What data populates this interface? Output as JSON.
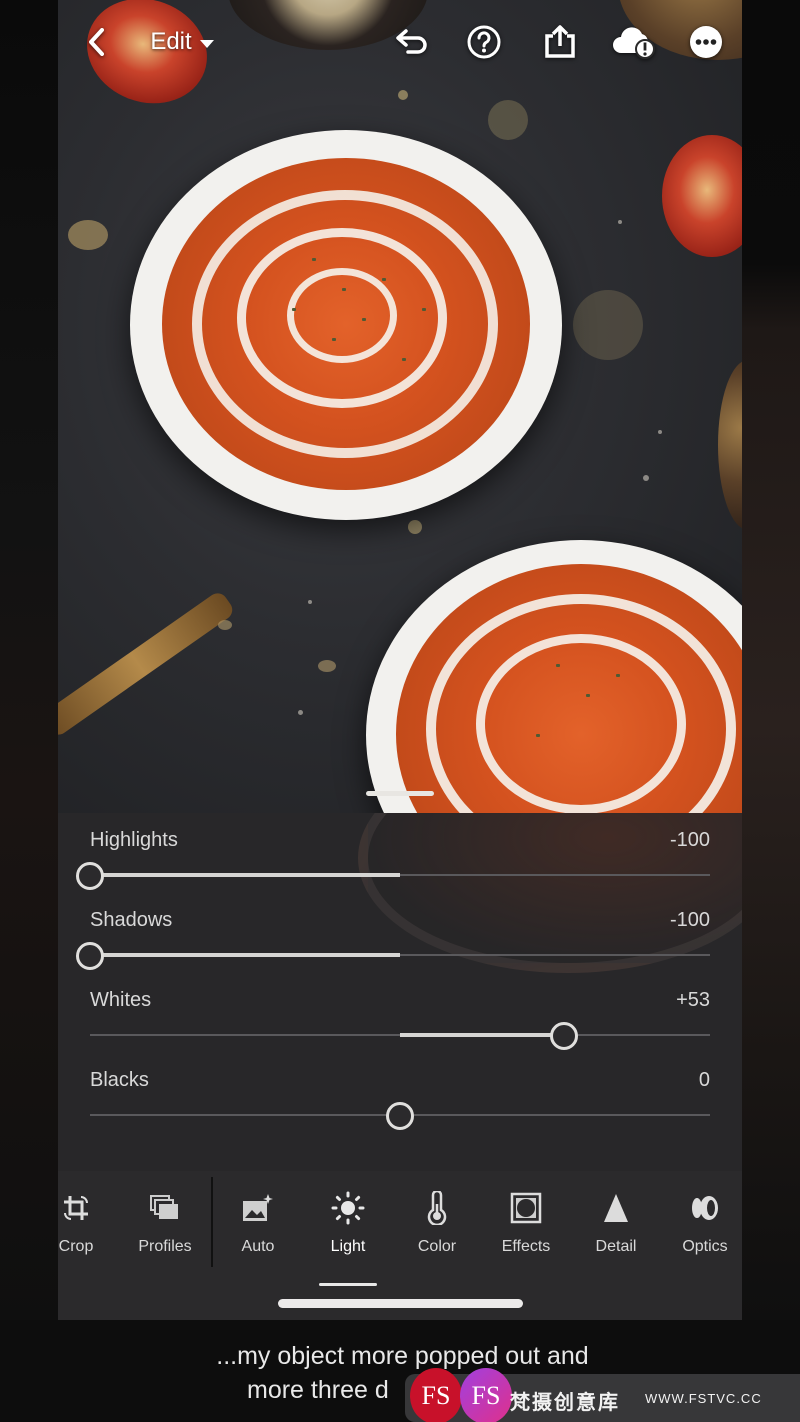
{
  "topbar": {
    "back_icon": "chevron-left-icon",
    "title": "Edit",
    "title_dropdown_icon": "caret-down-icon",
    "actions": [
      {
        "name": "undo",
        "icon": "undo-icon"
      },
      {
        "name": "help",
        "icon": "help-icon"
      },
      {
        "name": "share",
        "icon": "share-icon"
      },
      {
        "name": "cloud-sync-warning",
        "icon": "cloud-alert-icon"
      },
      {
        "name": "more",
        "icon": "more-icon"
      }
    ]
  },
  "light_panel": {
    "sliders": [
      {
        "label": "Highlights",
        "value_text": "-100",
        "value": -100,
        "min": -100,
        "max": 100
      },
      {
        "label": "Shadows",
        "value_text": "-100",
        "value": -100,
        "min": -100,
        "max": 100
      },
      {
        "label": "Whites",
        "value_text": "+53",
        "value": 53,
        "min": -100,
        "max": 100
      },
      {
        "label": "Blacks",
        "value_text": "0",
        "value": 0,
        "min": -100,
        "max": 100
      }
    ]
  },
  "tools": {
    "items": [
      {
        "label": "Crop",
        "icon": "crop-icon",
        "active": false
      },
      {
        "label": "Profiles",
        "icon": "profiles-icon",
        "active": false
      },
      {
        "label": "Auto",
        "icon": "auto-icon",
        "active": false
      },
      {
        "label": "Light",
        "icon": "light-icon",
        "active": true
      },
      {
        "label": "Color",
        "icon": "color-icon",
        "active": false
      },
      {
        "label": "Effects",
        "icon": "effects-icon",
        "active": false
      },
      {
        "label": "Detail",
        "icon": "detail-icon",
        "active": false
      },
      {
        "label": "Optics",
        "icon": "optics-icon",
        "active": false
      }
    ]
  },
  "captions": {
    "line1": "...my object more popped out and",
    "line2": "more three d"
  },
  "watermark": {
    "logo_text": "FS",
    "name": "梵摄创意库",
    "url": "WWW.FSTVC.CC"
  }
}
